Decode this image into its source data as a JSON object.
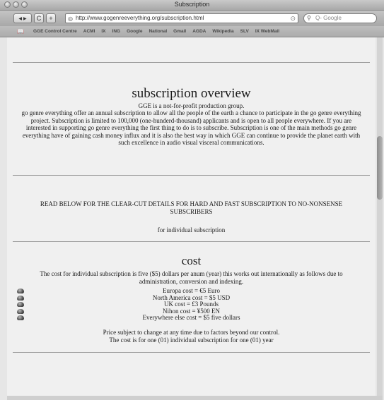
{
  "window": {
    "title": "Subscription"
  },
  "toolbar": {
    "back": "◀",
    "forward": "▶",
    "reload": "C",
    "add": "+",
    "url": "http://www.gogenreeverything.org/subscription.html",
    "search_placeholder": "Q- Google"
  },
  "bookmarks": [
    "GGE Control Centre",
    "ACMI",
    "IX",
    "ING",
    "Google",
    "National",
    "Gmail",
    "AGDA",
    "Wikipedia",
    "SLV",
    "IX WebMail"
  ],
  "page": {
    "heading": "subscription overview",
    "tagline": "GGE is a not-for-profit production group.",
    "intro": "go genre everything offer an annual subscription to allow all the people of the earth a chance to participate in the go genre everything project. Subscription is limited to 100,000 (one-hunderd-thousand) applicants and is open to all people everywhere. If you are interested in supporting go genre everything the first thing to do is to subscribe. Subscription is one of the main methods go genre everything have of gaining cash money influx and it is also the best way in which GGE can continue to provide the planet earth with such excellence in audio visual visceral communications.",
    "notice": "READ BELOW FOR THE CLEAR-CUT DETAILS FOR HARD AND FAST SUBSCRIPTION TO NO-NONSENSE SUBSCRIBERS",
    "individual": "for individual subscription",
    "cost_heading": "cost",
    "cost_text": "The cost for individual subscription is five ($5) dollars per anum (year) this works out internationally as follows due to administration, conversion and indexing.",
    "prices": [
      "Europa cost = €5 Euro",
      "North America cost = $5 USD",
      "UK cost = £3 Pounds",
      "Nihon cost = ¥500 EN",
      "Everywhere else cost = $5 five dollars"
    ],
    "note1": "Price subject to change at any time due to factors beyond our control.",
    "note2": "The cost is for one (01) individual subscription for one (01) year"
  }
}
